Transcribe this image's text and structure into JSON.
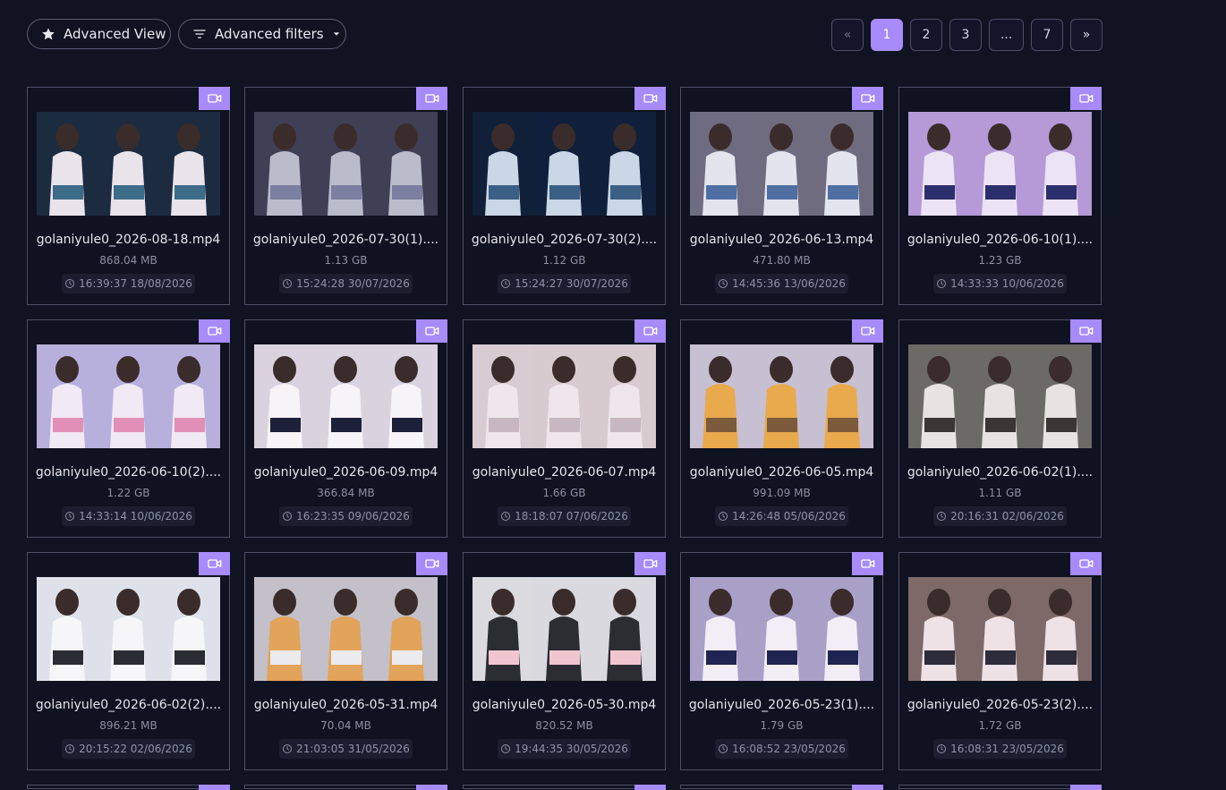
{
  "toolbar": {
    "advanced_view_label": "Advanced View",
    "advanced_filters_label": "Advanced filters"
  },
  "pagination": {
    "prev": "«",
    "pages": [
      "1",
      "2",
      "3",
      "...",
      "7"
    ],
    "next": "»",
    "current": "1"
  },
  "colors": {
    "accent": "#a78bfa",
    "background": "#101322"
  },
  "icons": {
    "toolbar_view": "star-icon",
    "toolbar_filters": "filter-icon",
    "badge": "video-camera-icon",
    "date": "clock-icon"
  },
  "files": [
    {
      "name": "golaniyule0_2026-08-18.mp4",
      "size": "868.04 MB",
      "date": "16:39:37 18/08/2026"
    },
    {
      "name": "golaniyule0_2026-07-30(1)....",
      "size": "1.13 GB",
      "date": "15:24:28 30/07/2026"
    },
    {
      "name": "golaniyule0_2026-07-30(2)....",
      "size": "1.12 GB",
      "date": "15:24:27 30/07/2026"
    },
    {
      "name": "golaniyule0_2026-06-13.mp4",
      "size": "471.80 MB",
      "date": "14:45:36 13/06/2026"
    },
    {
      "name": "golaniyule0_2026-06-10(1)....",
      "size": "1.23 GB",
      "date": "14:33:33 10/06/2026"
    },
    {
      "name": "golaniyule0_2026-06-10(2)....",
      "size": "1.22 GB",
      "date": "14:33:14 10/06/2026"
    },
    {
      "name": "golaniyule0_2026-06-09.mp4",
      "size": "366.84 MB",
      "date": "16:23:35 09/06/2026"
    },
    {
      "name": "golaniyule0_2026-06-07.mp4",
      "size": "1.66 GB",
      "date": "18:18:07 07/06/2026"
    },
    {
      "name": "golaniyule0_2026-06-05.mp4",
      "size": "991.09 MB",
      "date": "14:26:48 05/06/2026"
    },
    {
      "name": "golaniyule0_2026-06-02(1)....",
      "size": "1.11 GB",
      "date": "20:16:31 02/06/2026"
    },
    {
      "name": "golaniyule0_2026-06-02(2)....",
      "size": "896.21 MB",
      "date": "20:15:22 02/06/2026"
    },
    {
      "name": "golaniyule0_2026-05-31.mp4",
      "size": "70.04 MB",
      "date": "21:03:05 31/05/2026"
    },
    {
      "name": "golaniyule0_2026-05-30.mp4",
      "size": "820.52 MB",
      "date": "19:44:35 30/05/2026"
    },
    {
      "name": "golaniyule0_2026-05-23(1)....",
      "size": "1.79 GB",
      "date": "16:08:52 23/05/2026"
    },
    {
      "name": "golaniyule0_2026-05-23(2)....",
      "size": "1.72 GB",
      "date": "16:08:31 23/05/2026"
    }
  ]
}
